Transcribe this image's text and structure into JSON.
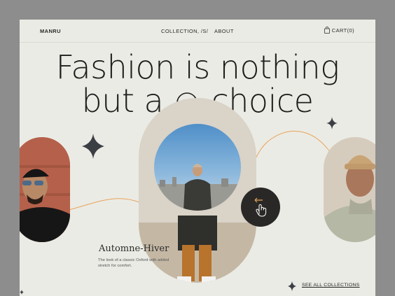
{
  "nav": {
    "brand": "MANRU",
    "links": [
      "COLLECTION, /S/",
      "ABOUT"
    ],
    "cart": "CART(0)"
  },
  "hero": {
    "line1": "Fashion is nothing",
    "line2_a": "but a",
    "line2_b": "choice"
  },
  "collection": {
    "title": "Automne-Hiver",
    "description": "The look of a classic Oxford with added stretch for comfort."
  },
  "cta": {
    "see_all": "SEE ALL COLLECTIONS"
  },
  "icons": [
    "bag-icon",
    "smiley-icon",
    "sparkle-icon",
    "arrow-left-icon",
    "pointer-hand-icon"
  ],
  "colors": {
    "page_bg": "#ebebe5",
    "outer_bg": "#8d8d8d",
    "accent_line": "#e8a35a",
    "dark": "#2a2826"
  }
}
